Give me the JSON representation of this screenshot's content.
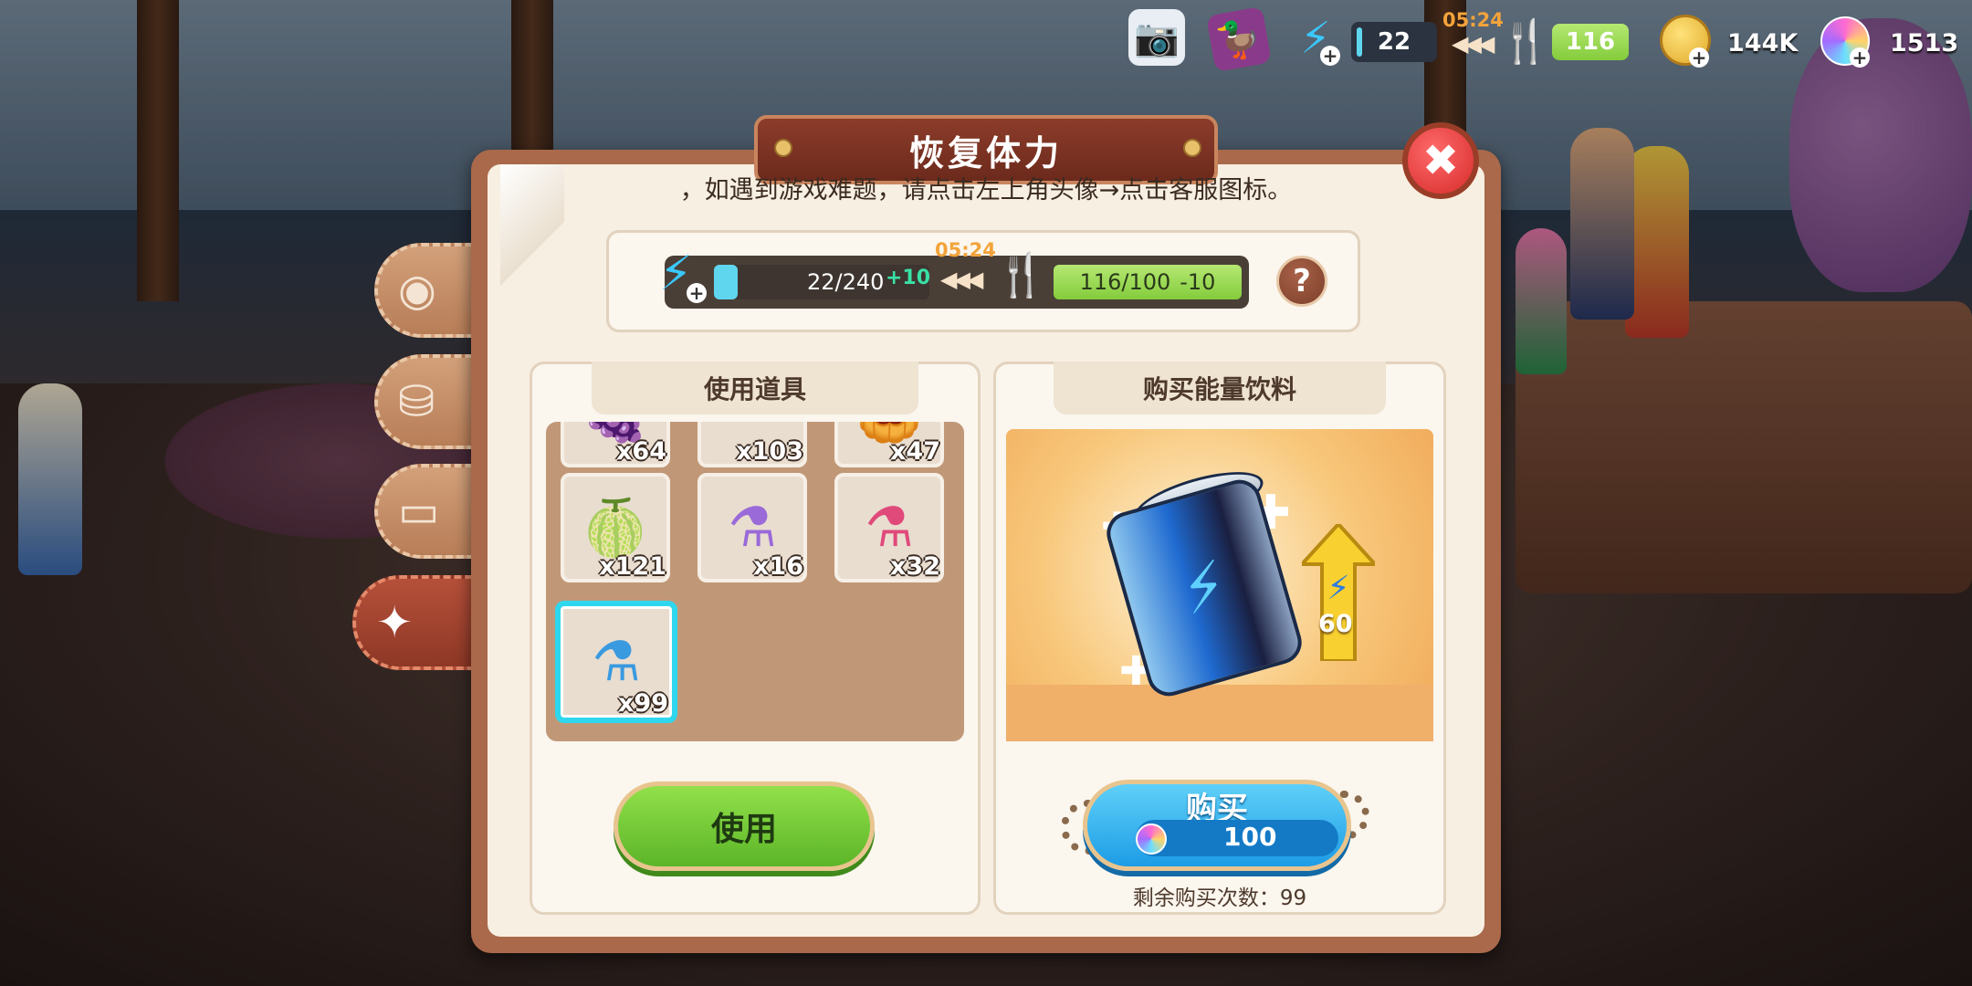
{
  "hud": {
    "energy_value": "22",
    "energy_timer": "05:24",
    "food_value": "116",
    "coins_value": "144K",
    "gems_value": "1513"
  },
  "dialog": {
    "title": "恢复体力",
    "notice": "，如遇到游戏难题，请点击左上角头像→点击客服图标。",
    "status": {
      "timer": "05:24",
      "energy": "22/240",
      "energy_bonus": "+10",
      "food": "116/100",
      "food_bonus": "-10"
    },
    "use_panel": {
      "header": "使用道具",
      "items_top_partial": [
        {
          "icon": "grape-icon",
          "count": "x64"
        },
        {
          "icon": "item-icon",
          "count": "x103"
        },
        {
          "icon": "orange-food-icon",
          "count": "x47"
        }
      ],
      "items": [
        {
          "icon": "melon-icon",
          "count": "x121"
        },
        {
          "icon": "purple-potion-icon",
          "count": "x16"
        },
        {
          "icon": "pink-potion-icon",
          "count": "x32"
        },
        {
          "icon": "blue-potion-icon",
          "count": "x99",
          "selected": true
        }
      ],
      "use_button": "使用"
    },
    "buy_panel": {
      "header": "购买能量饮料",
      "energy_gain": "60",
      "buy_button": "购买",
      "price": "100",
      "remaining": "剩余购买次数：99"
    }
  },
  "colors": {
    "accent_red": "#8c3c2a",
    "use_green": "#5bb528",
    "buy_blue": "#1d9ce6",
    "selected_cyan": "#2ed7ee"
  }
}
